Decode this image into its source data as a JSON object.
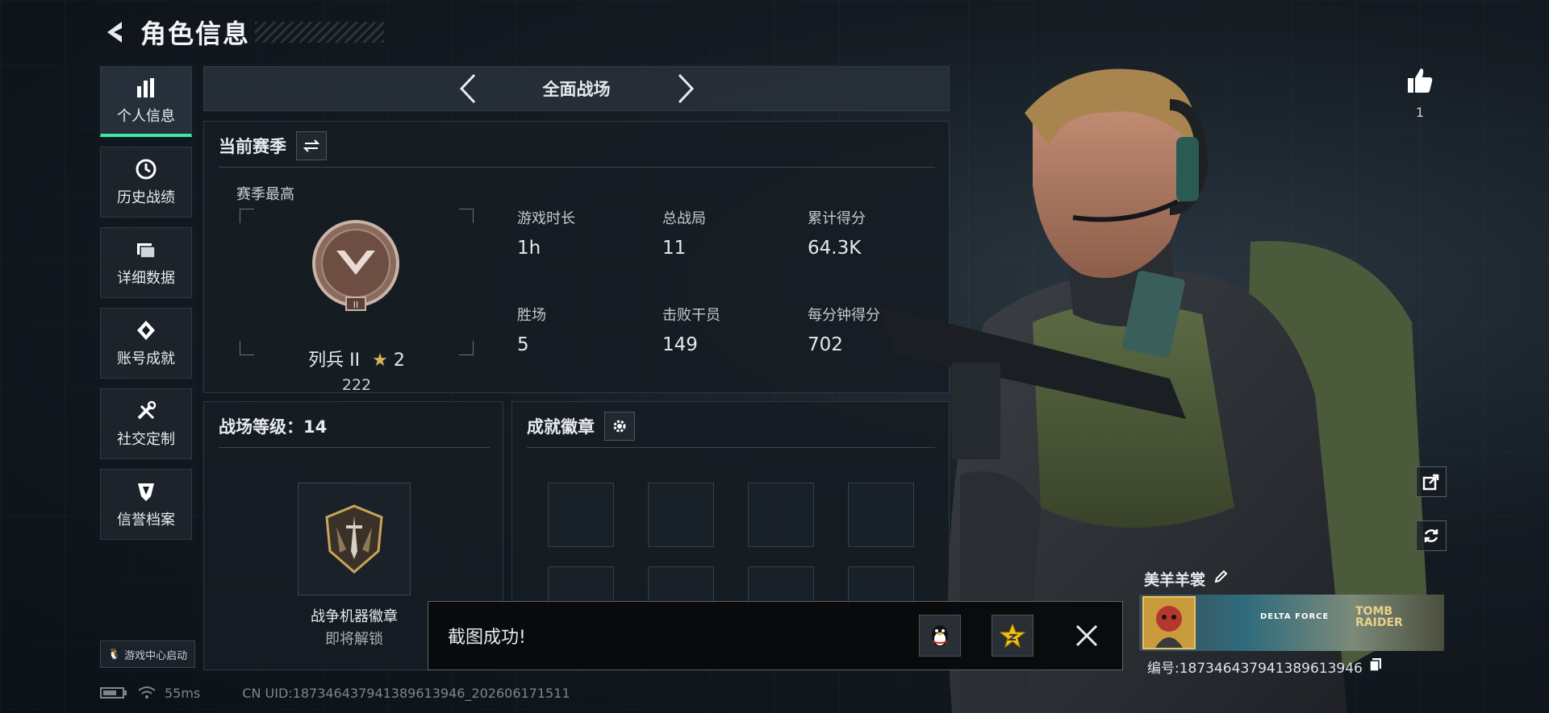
{
  "header": {
    "title": "角色信息"
  },
  "sidebar": {
    "items": [
      {
        "label": "个人信息",
        "icon": "bar-chart-icon",
        "active": true
      },
      {
        "label": "历史战绩",
        "icon": "clock-icon",
        "active": false
      },
      {
        "label": "详细数据",
        "icon": "folder-icon",
        "active": false
      },
      {
        "label": "账号成就",
        "icon": "medal-icon",
        "active": false
      },
      {
        "label": "社交定制",
        "icon": "tools-icon",
        "active": false
      },
      {
        "label": "信誉档案",
        "icon": "shield-icon",
        "active": false
      }
    ],
    "launch_badge": "游戏中心启动"
  },
  "mode": {
    "label": "全面战场"
  },
  "season": {
    "title": "当前赛季",
    "subtitle": "赛季最高",
    "rank_name": "列兵 II",
    "rank_stars": "2",
    "rank_score": "222",
    "stats": [
      {
        "label": "游戏时长",
        "value": "1h"
      },
      {
        "label": "总战局",
        "value": "11"
      },
      {
        "label": "累计得分",
        "value": "64.3K"
      },
      {
        "label": "胜场",
        "value": "5"
      },
      {
        "label": "击败干员",
        "value": "149"
      },
      {
        "label": "每分钟得分",
        "value": "702"
      }
    ]
  },
  "level": {
    "title": "战场等级：14",
    "badge_name": "战争机器徽章",
    "badge_status": "即将解锁"
  },
  "achievements": {
    "title": "成就徽章"
  },
  "toast": {
    "message": "截图成功!"
  },
  "footer": {
    "ping": "55ms",
    "uid": "CN UID:18734643794138961394​6_202606171511"
  },
  "player": {
    "likes": "1",
    "name": "美羊羊裳",
    "id": "编号:187346437941389613946",
    "banner_logo_1": "DELTA FORCE",
    "banner_logo_2": "TOMB RAIDER"
  },
  "colors": {
    "accent": "#3ee8a5",
    "panel": "#161c23",
    "gold": "#c99b3d"
  }
}
